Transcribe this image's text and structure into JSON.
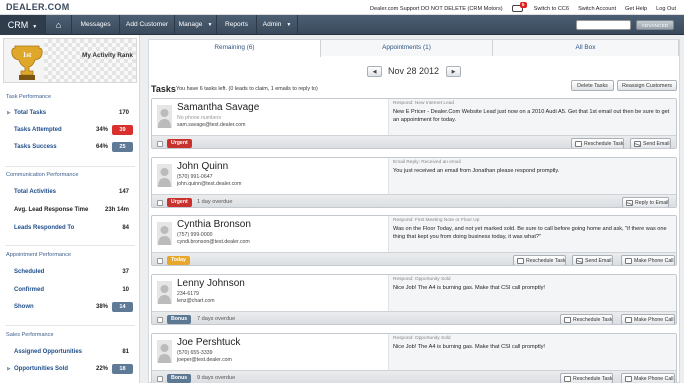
{
  "topbar": {
    "logo": "DEALER.COM",
    "support_text": "Dealer.com Support DO NOT DELETE (CRM Motors)",
    "notif_count": "5",
    "links": [
      "Switch to CC6",
      "Switch Account",
      "Get Help",
      "Log Out"
    ]
  },
  "nav": {
    "crm": "CRM",
    "items": [
      "Messages",
      "Add Customer",
      "Manage",
      "Reports",
      "Admin"
    ],
    "search_placeholder": "",
    "search_button": "ADVANCED"
  },
  "sidebar": {
    "rank_label": "My Activity Rank",
    "trophy_text": "1st",
    "sections": [
      {
        "title": "Task Performance",
        "metrics": [
          {
            "label": "Total Tasks",
            "pct": "",
            "value": "170",
            "chip": ""
          },
          {
            "label": "Tasks Attempted",
            "pct": "34%",
            "value": "",
            "chip": "39"
          },
          {
            "label": "Tasks Success",
            "pct": "64%",
            "value": "",
            "chip": "25"
          }
        ]
      },
      {
        "title": "Communication Performance",
        "metrics": [
          {
            "label": "Total Activities",
            "pct": "",
            "value": "147",
            "chip": ""
          },
          {
            "label": "Avg. Lead Response Time",
            "pct": "",
            "value": "23h 14m",
            "chip": ""
          },
          {
            "label": "Leads Responded To",
            "pct": "",
            "value": "84",
            "chip": ""
          }
        ]
      },
      {
        "title": "Appointment Performance",
        "metrics": [
          {
            "label": "Scheduled",
            "pct": "",
            "value": "37",
            "chip": ""
          },
          {
            "label": "Confirmed",
            "pct": "",
            "value": "10",
            "chip": ""
          },
          {
            "label": "Shown",
            "pct": "38%",
            "value": "",
            "chip": "14"
          }
        ]
      },
      {
        "title": "Sales Performance",
        "metrics": [
          {
            "label": "Assigned Opportunities",
            "pct": "",
            "value": "81",
            "chip": ""
          },
          {
            "label": "Opportunities Sold",
            "pct": "22%",
            "value": "",
            "chip": "18"
          }
        ]
      }
    ]
  },
  "main": {
    "tabs": [
      "Remaining (6)",
      "Appointments (1)",
      "All Box"
    ],
    "date": "Nov 28 2012",
    "tasks_title": "Tasks",
    "tasks_subtitle": "You have 6 tasks left. (0 leads to claim, 1 emails to reply to)",
    "delete_button": "Delete Tasks",
    "reassign_button": "Reassign Customers",
    "cards": [
      {
        "name": "Samantha Savage",
        "info1": "No phone numbers",
        "info2": "sam.savage@test.dealer.com",
        "header": "Respond: New Internet Lead",
        "body": "New E Pricer - Dealer.Com Website Lead just now on a 2010 Audi A5.  Get that 1st email out then be sure to get an appointment for today.",
        "tag": "Urgent",
        "overdue": "",
        "buttons": [
          "Reschedule Task",
          "Send Email"
        ]
      },
      {
        "name": "John Quinn",
        "info1": "(570) 991-0647",
        "info2": "john.quinn@test.dealer.com",
        "header": "Email Reply: Received an email",
        "body": "You just received an email from Jonathan please respond promptly.",
        "tag": "Urgent",
        "overdue": "1 day overdue",
        "buttons": [
          "Reply to Email"
        ]
      },
      {
        "name": "Cynthia Bronson",
        "info1": "(757) 999-0000",
        "info2": "cyndi.bronson@test.dealer.com",
        "header": "Respond: First Meeting Note or Floor Up",
        "body": "Was on the Floor Today, and not yet marked sold.  Be sure to call before going home and ask, \"if there was one thing that kept you from doing business today, it was what?\"",
        "tag": "Today",
        "overdue": "",
        "buttons": [
          "Reschedule Task",
          "Send Email",
          "Make Phone Call"
        ]
      },
      {
        "name": "Lenny Johnson",
        "info1": "234-6179",
        "info2": "lenz@chart.com",
        "header": "Respond: Opportunity Sold",
        "body": "Nice Job!  The A4 is burning gas.  Make that CSI call promptly!",
        "tag": "Bonus",
        "overdue": "7 days overdue",
        "buttons": [
          "Reschedule Task",
          "Make Phone Call"
        ]
      },
      {
        "name": "Joe Pershtuck",
        "info1": "(570) 655-3339",
        "info2": "joeper@test.dealer.com",
        "header": "Respond: Opportunity Sold",
        "body": "Nice Job!  The A4 is burning gas.  Make that CSI call promptly!",
        "tag": "Bonus",
        "overdue": "9 days overdue",
        "buttons": [
          "Reschedule Task",
          "Make Phone Call"
        ]
      }
    ]
  },
  "colors": {
    "nav_bg": "#3a4a5c",
    "urgent": "#c9312d",
    "today": "#e8a72a",
    "bonus": "#5d7892",
    "link": "#1f4e8c"
  }
}
